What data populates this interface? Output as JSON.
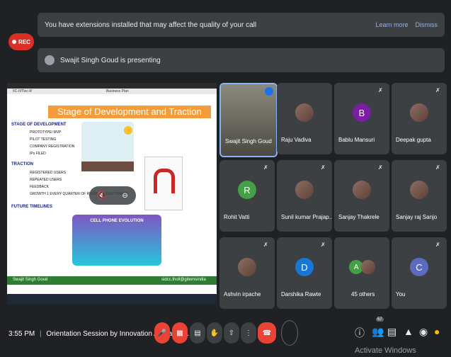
{
  "banner": {
    "message": "You have extensions installed that may affect the quality of your call",
    "learn_more": "Learn more",
    "dismiss": "Dismiss"
  },
  "recording": {
    "label": "REC"
  },
  "presenting": {
    "text": "Swajit Singh Goud is presenting"
  },
  "slide": {
    "header_left": "IIC-0/Tlec-R",
    "header_right": "Business Plan",
    "title": "Stage of Development and Traction",
    "sections": [
      {
        "heading": "STAGE OF DEVELOPMENT",
        "items": [
          "PROTOTYPE/ MVP",
          "PILOT TESTING",
          "COMPANY REGISTRATION",
          "IPs FILED"
        ]
      },
      {
        "heading": "TRACTION",
        "items": [
          "REGISTERED USERS",
          "REPEATED USERS",
          "FEEDBACK",
          "GROWTH 1 EVERY QUARTER OF REVENUE/ CUSTOMERS"
        ]
      },
      {
        "heading": "FUTURE TIMELINES",
        "items": []
      }
    ],
    "image_caption": "CELL PHONE EVOLUTION",
    "footer_left": "Swajit Singh Goud",
    "footer_right": "sidcc.tholl@gitemsindia"
  },
  "participants": [
    {
      "name": "Swajit Singh Goud",
      "type": "photo",
      "active": true
    },
    {
      "name": "Raju Vadiva",
      "type": "photo",
      "muted": false
    },
    {
      "name": "Bablu Mansuri",
      "type": "letter",
      "letter": "B",
      "color": "#7b1fa2",
      "muted": true
    },
    {
      "name": "Deepak gupta",
      "type": "photo",
      "muted": true
    },
    {
      "name": "Rohit Vatti",
      "type": "letter",
      "letter": "R",
      "color": "#43a047",
      "muted": true
    },
    {
      "name": "Sunil kumar Prajap...",
      "type": "photo",
      "muted": true
    },
    {
      "name": "Sanjay Thakrele",
      "type": "photo",
      "muted": true
    },
    {
      "name": "Sanjay raj Sanjo",
      "type": "photo",
      "muted": true
    },
    {
      "name": "Ashvin irpache",
      "type": "photo",
      "muted": true
    },
    {
      "name": "Darshika Rawte",
      "type": "letter",
      "letter": "D",
      "color": "#1976d2",
      "muted": true
    },
    {
      "name": "45 others",
      "type": "others",
      "letter": "A",
      "color": "#43a047"
    },
    {
      "name": "You",
      "type": "letter",
      "letter": "C",
      "color": "#5c6bc0",
      "muted": true
    }
  ],
  "bottom": {
    "time": "3:55 PM",
    "meeting": "Orientation Session by Innovation Ambassa...",
    "participant_count": "57",
    "activate": "Activate Windows"
  },
  "icons": {
    "mic_off": "mic-off-icon",
    "cam_off": "camera-off-icon",
    "captions": "captions-icon",
    "hand": "raise-hand-icon",
    "present": "present-icon",
    "more": "more-icon",
    "end": "end-call-icon",
    "info": "info-icon",
    "people": "people-icon",
    "chat": "chat-icon",
    "activities": "activities-icon",
    "lock": "lock-icon",
    "bulb": "bulb-icon"
  }
}
